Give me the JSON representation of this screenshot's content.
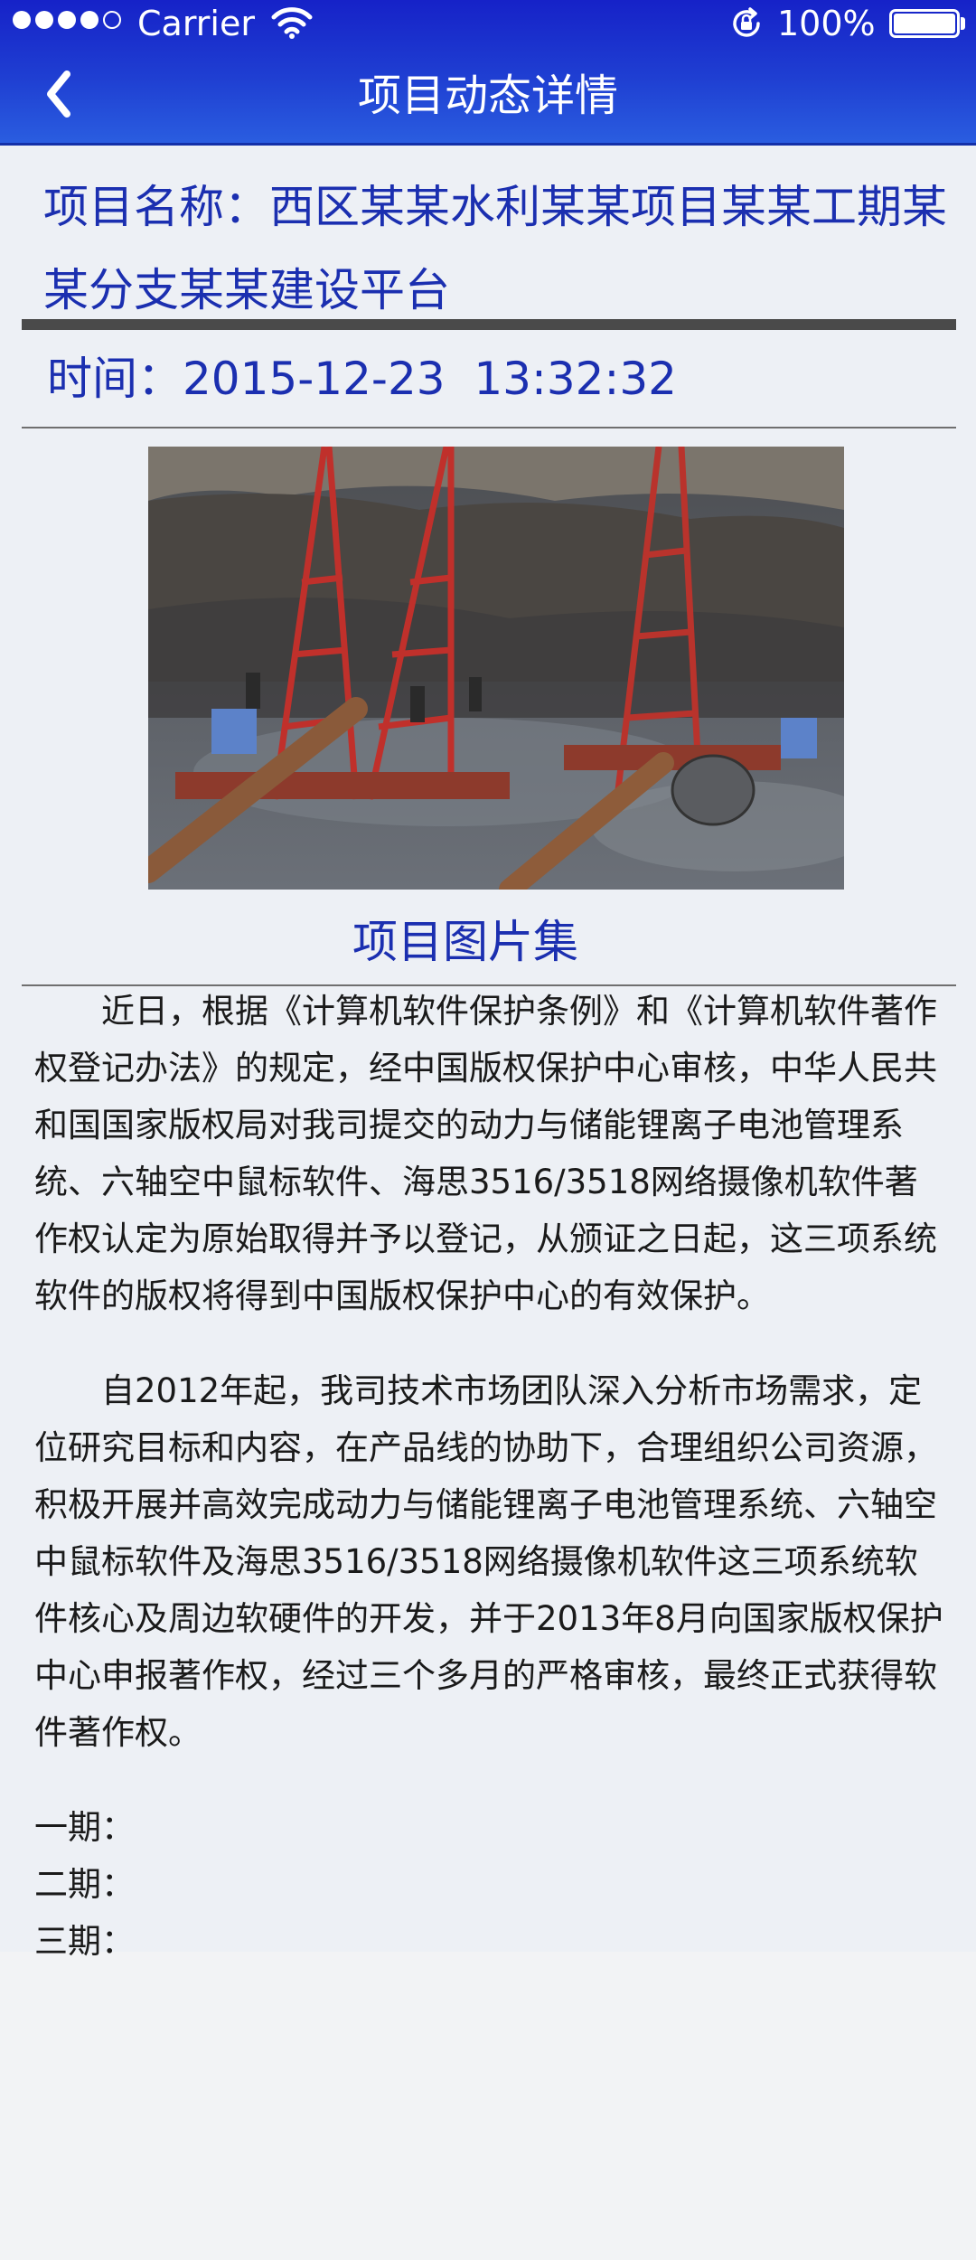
{
  "status_bar": {
    "carrier": "Carrier",
    "battery_percent": "100%",
    "battery_level": 1.0,
    "signal_bars_filled": 4,
    "signal_bars_total": 5
  },
  "nav": {
    "title": "项目动态详情",
    "back_icon": "chevron-left-icon"
  },
  "project": {
    "name": "项目名称：西区某某水利某某项目某某工期某某分支某某建设平台",
    "time_label": "时间：",
    "date": "2015-12-23",
    "time": "13:32:32",
    "gallery_link": "项目图片集"
  },
  "article": {
    "paragraph_1": "近日，根据《计算机软件保护条例》和《计算机软件著作权登记办法》的规定，经中国版权保护中心审核，中华人民共和国国家版权局对我司提交的动力与储能锂离子电池管理系统、六轴空中鼠标软件、海思3516/3518网络摄像机软件著作权认定为原始取得并予以登记，从颁证之日起，这三项系统软件的版权将得到中国版权保护中心的有效保护。",
    "paragraph_2": "自2012年起，我司技术市场团队深入分析市场需求，定位研究目标和内容，在产品线的协助下，合理组织公司资源，积极开展并高效完成动力与储能锂离子电池管理系统、六轴空中鼠标软件及海思3516/3518网络摄像机软件这三项系统软件核心及周边软硬件的开发，并于2013年8月向国家版权保护中心申报著作权，经过三个多月的严格审核，最终正式获得软件著作权。",
    "phases": [
      "一期：",
      "二期：",
      "三期："
    ]
  },
  "colors": {
    "nav_bar": "#1f3fd2",
    "accent_text": "#1b2fb0",
    "content_bg": "#edf0f5",
    "body_text": "#1a1a1a"
  }
}
